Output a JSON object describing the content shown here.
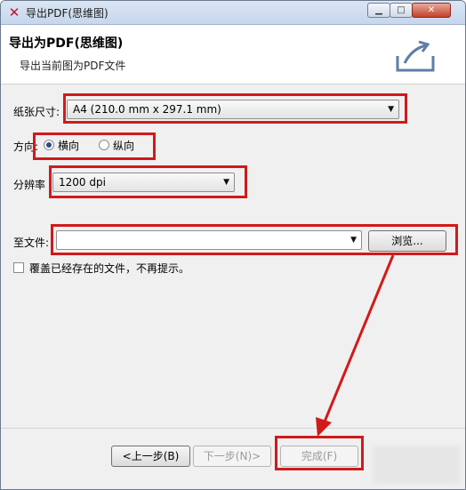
{
  "window": {
    "title": "导出PDF(思维图)",
    "app_icon": "x-logo-icon",
    "controls": [
      "minimize-icon",
      "maximize-icon",
      "close-icon"
    ]
  },
  "header": {
    "title": "导出为PDF(思维图)",
    "subtitle": "导出当前图为PDF文件",
    "icon": "export-icon"
  },
  "form": {
    "paper_size": {
      "label": "纸张尺寸:",
      "value": "A4 (210.0 mm x 297.1 mm)"
    },
    "orientation": {
      "label": "方向:",
      "options": [
        {
          "label": "横向",
          "checked": true
        },
        {
          "label": "纵向",
          "checked": false
        }
      ]
    },
    "resolution": {
      "label": "分辨率",
      "value": "1200 dpi"
    },
    "file": {
      "label": "至文件:",
      "value": "",
      "browse_label": "浏览..."
    },
    "overwrite": {
      "label": "覆盖已经存在的文件，不再提示。",
      "checked": false
    }
  },
  "footer": {
    "prev_label": "<上一步(B)",
    "next_label": "下一步(N)>",
    "finish_label": "完成(F)"
  },
  "colors": {
    "highlight": "#d11a1a",
    "title_bar": "#c6d6ec"
  }
}
